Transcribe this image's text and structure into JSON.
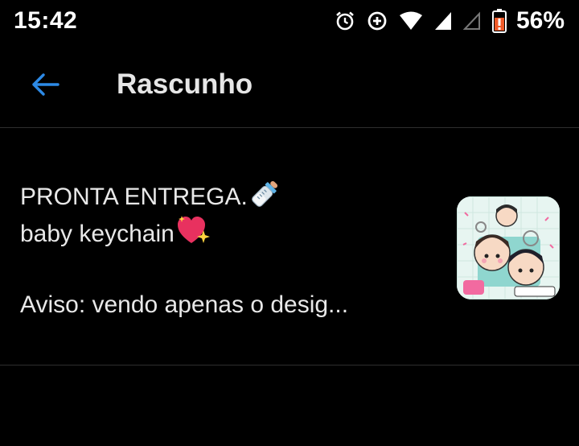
{
  "status_bar": {
    "time": "15:42",
    "battery_percent": "56%",
    "icons": [
      "alarm-icon",
      "data-saver-icon",
      "wifi-icon",
      "signal-icon",
      "signal-empty-icon",
      "battery-icon"
    ]
  },
  "app_bar": {
    "back_icon": "arrow-left-icon",
    "title": "Rascunho",
    "accent_color": "#2d8ae6"
  },
  "draft": {
    "line1": "PRONTA ENTREGA.",
    "line1_emoji": "baby-bottle-icon",
    "line2": "baby keychain",
    "line2_emoji": "sparkling-heart-icon",
    "line3": "Aviso: vendo apenas o desig...",
    "thumbnail": "sticker-keychain-image"
  }
}
